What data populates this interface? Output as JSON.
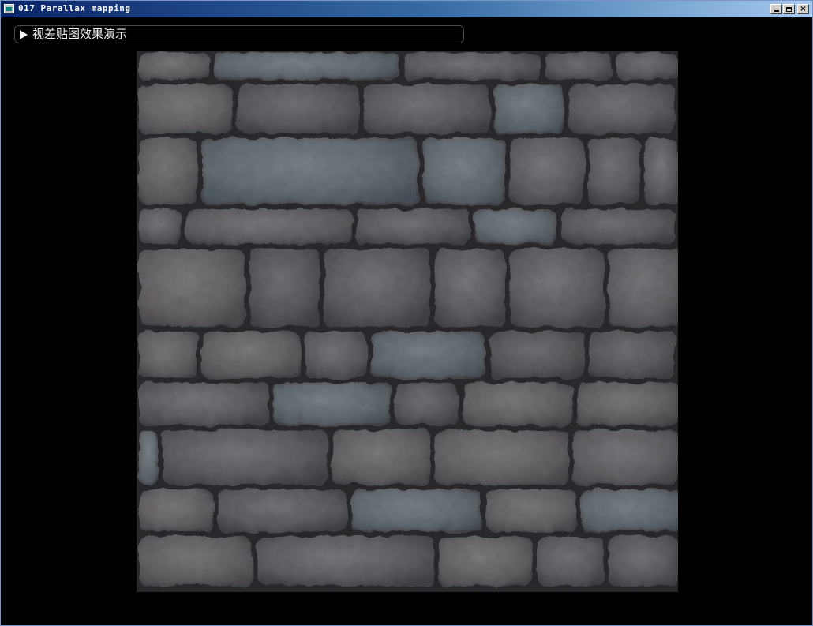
{
  "window": {
    "title": "017 Parallax mapping",
    "controls": {
      "minimize": "_",
      "maximize": "□",
      "close": "✕"
    }
  },
  "panel": {
    "label": "视差贴图效果演示",
    "state": "expanded",
    "icon": "triangle-right-icon"
  },
  "viewport": {
    "content": "stone-brick-wall-texture",
    "colors": {
      "stone": "#5f5f62",
      "mortar": "#262629",
      "tint": "#5a7f8f"
    }
  }
}
